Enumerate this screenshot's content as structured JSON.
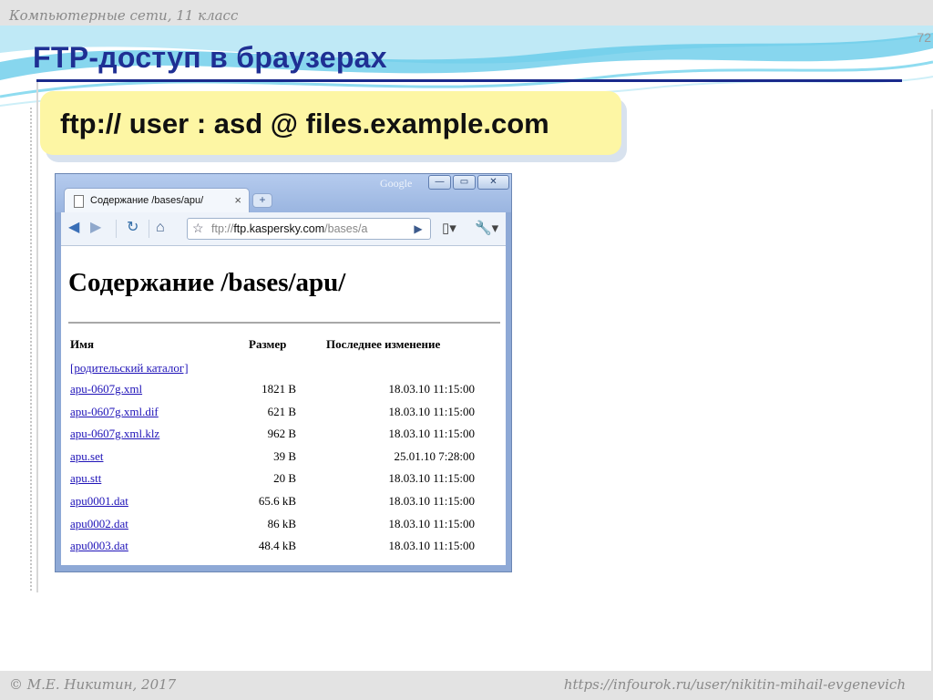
{
  "slide": {
    "course": "Компьютерные сети, 11 класс",
    "number": "72",
    "title": "FTP-доступ в браузерах",
    "url_syntax": "ftp:// user : asd @ files.example.com",
    "footer_left": "© М.Е. Никитин, 2017",
    "footer_right": "https://infourok.ru/user/nikitin-mihail-evgenevich"
  },
  "browser": {
    "tab_title": "Содержание /bases/apu/",
    "tab_close": "×",
    "new_tab": "+",
    "google_label": "Google",
    "window_buttons": {
      "minimize": "—",
      "maximize": "▭",
      "close": "✕"
    },
    "icons": {
      "back": "arrow-left-icon",
      "forward": "arrow-right-icon",
      "reload": "reload-icon",
      "home": "home-icon",
      "star": "star-icon",
      "go": "play-icon",
      "page_menu": "page-menu-icon",
      "wrench": "wrench-icon"
    },
    "glyphs": {
      "back": "◀",
      "forward": "▶",
      "reload": "↻",
      "home": "⌂",
      "star": "☆",
      "go": "▶",
      "page_menu": "▯▾",
      "wrench": "🔧▾"
    },
    "address_scheme": "ftp://",
    "address_host": "ftp.kaspersky.com",
    "address_path": "/bases/a"
  },
  "listing": {
    "heading": "Содержание /bases/apu/",
    "columns": {
      "name": "Имя",
      "size": "Размер",
      "modified": "Последнее изменение"
    },
    "parent_link": "[родительский каталог]",
    "rows": [
      {
        "name": "apu-0607g.xml",
        "size": "1821 B",
        "modified": "18.03.10 11:15:00"
      },
      {
        "name": "apu-0607g.xml.dif",
        "size": "621 B",
        "modified": "18.03.10 11:15:00"
      },
      {
        "name": "apu-0607g.xml.klz",
        "size": "962 B",
        "modified": "18.03.10 11:15:00"
      },
      {
        "name": "apu.set",
        "size": "39 B",
        "modified": "25.01.10 7:28:00"
      },
      {
        "name": "apu.stt",
        "size": "20 B",
        "modified": "18.03.10 11:15:00"
      },
      {
        "name": "apu0001.dat",
        "size": "65.6 kB",
        "modified": "18.03.10 11:15:00"
      },
      {
        "name": "apu0002.dat",
        "size": "86 kB",
        "modified": "18.03.10 11:15:00"
      },
      {
        "name": "apu0003.dat",
        "size": "48.4 kB",
        "modified": "18.03.10 11:15:00"
      }
    ]
  },
  "colors": {
    "title": "#1f2f93",
    "rule": "#1a2a8c",
    "url_box": "#fdf6a4",
    "link": "#1f13b8",
    "wave": "#5fc8e8"
  }
}
